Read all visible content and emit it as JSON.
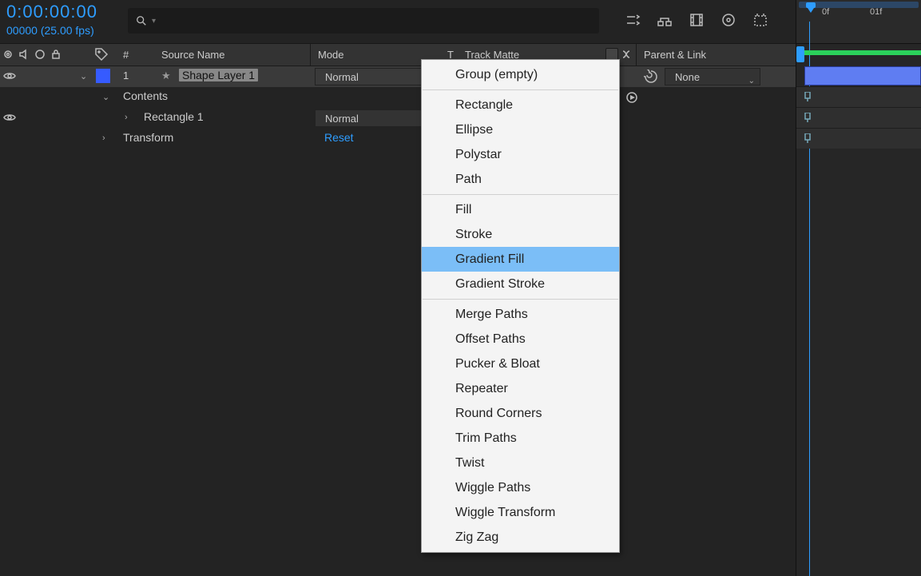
{
  "topbar": {
    "timecode": "0:00:00:00",
    "frameinfo": "00000 (25.00 fps)"
  },
  "columns": {
    "num": "#",
    "source_name": "Source Name",
    "mode": "Mode",
    "t": "T",
    "track_matte": "Track Matte",
    "parent": "Parent & Link"
  },
  "layers": [
    {
      "index": "1",
      "name": "Shape Layer 1",
      "mode": "Normal",
      "parent": "None",
      "children": {
        "contents_label": "Contents",
        "rectangle": {
          "name": "Rectangle 1",
          "mode": "Normal"
        },
        "transform": {
          "name": "Transform",
          "reset": "Reset"
        }
      }
    }
  ],
  "timeline": {
    "t0": "0f",
    "t1": "01f"
  },
  "context_menu": {
    "groups": [
      [
        "Group (empty)"
      ],
      [
        "Rectangle",
        "Ellipse",
        "Polystar",
        "Path"
      ],
      [
        "Fill",
        "Stroke",
        "Gradient Fill",
        "Gradient Stroke"
      ],
      [
        "Merge Paths",
        "Offset Paths",
        "Pucker & Bloat",
        "Repeater",
        "Round Corners",
        "Trim Paths",
        "Twist",
        "Wiggle Paths",
        "Wiggle Transform",
        "Zig Zag"
      ]
    ],
    "highlighted": "Gradient Fill"
  }
}
